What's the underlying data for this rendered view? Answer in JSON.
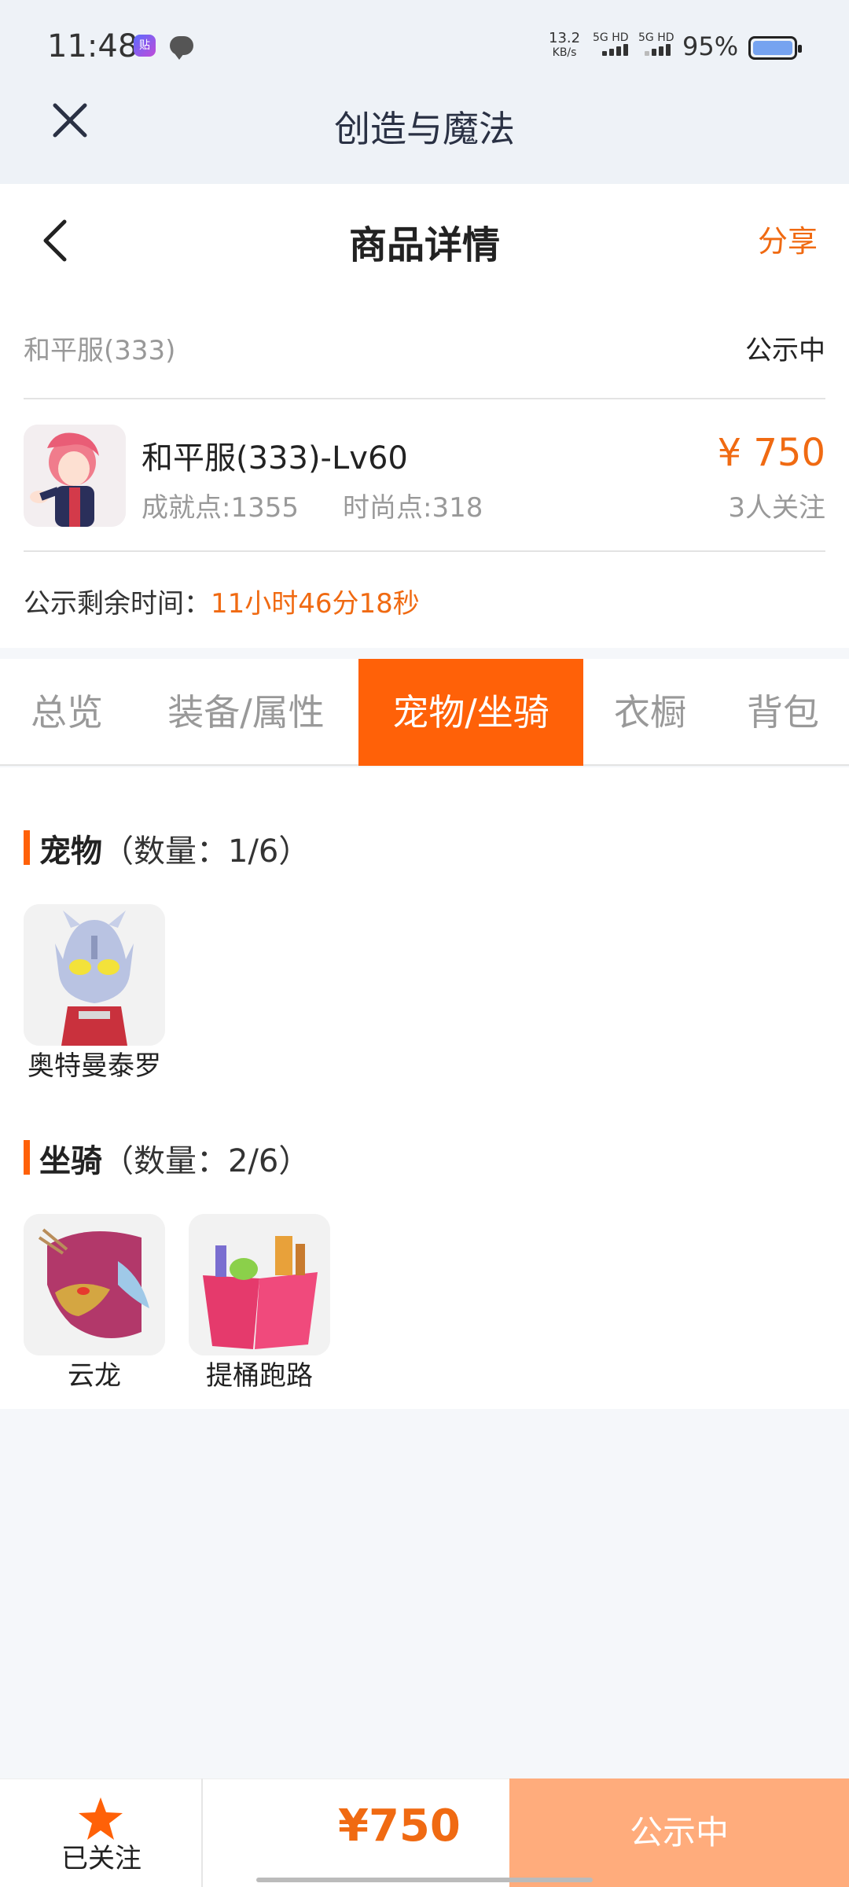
{
  "status": {
    "time": "11:48",
    "speed_top": "13.2",
    "speed_bottom": "KB/s",
    "net1": "5G HD",
    "net2": "5G HD",
    "battery": "95%"
  },
  "miniapp": {
    "title": "创造与魔法"
  },
  "header": {
    "title": "商品详情",
    "share": "分享"
  },
  "item": {
    "server": "和平服(333)",
    "status": "公示中",
    "name": "和平服(333)-Lv60",
    "achievement": "成就点:1355",
    "fashion": "时尚点:318",
    "price": "¥ 750",
    "followers": "3人关注",
    "remain_label": "公示剩余时间：",
    "remain_value": "11小时46分18秒"
  },
  "tabs": [
    {
      "label": "总览",
      "active": false
    },
    {
      "label": "装备/属性",
      "active": false
    },
    {
      "label": "宠物/坐骑",
      "active": true
    },
    {
      "label": "衣橱",
      "active": false
    },
    {
      "label": "背包",
      "active": false
    }
  ],
  "pets": {
    "title": "宠物",
    "qty": "（数量：1/6）",
    "items": [
      {
        "name": "奥特曼泰罗"
      }
    ]
  },
  "mounts": {
    "title": "坐骑",
    "qty": "（数量：2/6）",
    "items": [
      {
        "name": "云龙"
      },
      {
        "name": "提桶跑路"
      }
    ]
  },
  "bottom": {
    "follow_label": "已关注",
    "price": "¥750",
    "status_button": "公示中"
  },
  "colors": {
    "accent": "#ff6108",
    "price": "#f06a12",
    "disabled_button": "#ffac7c"
  }
}
